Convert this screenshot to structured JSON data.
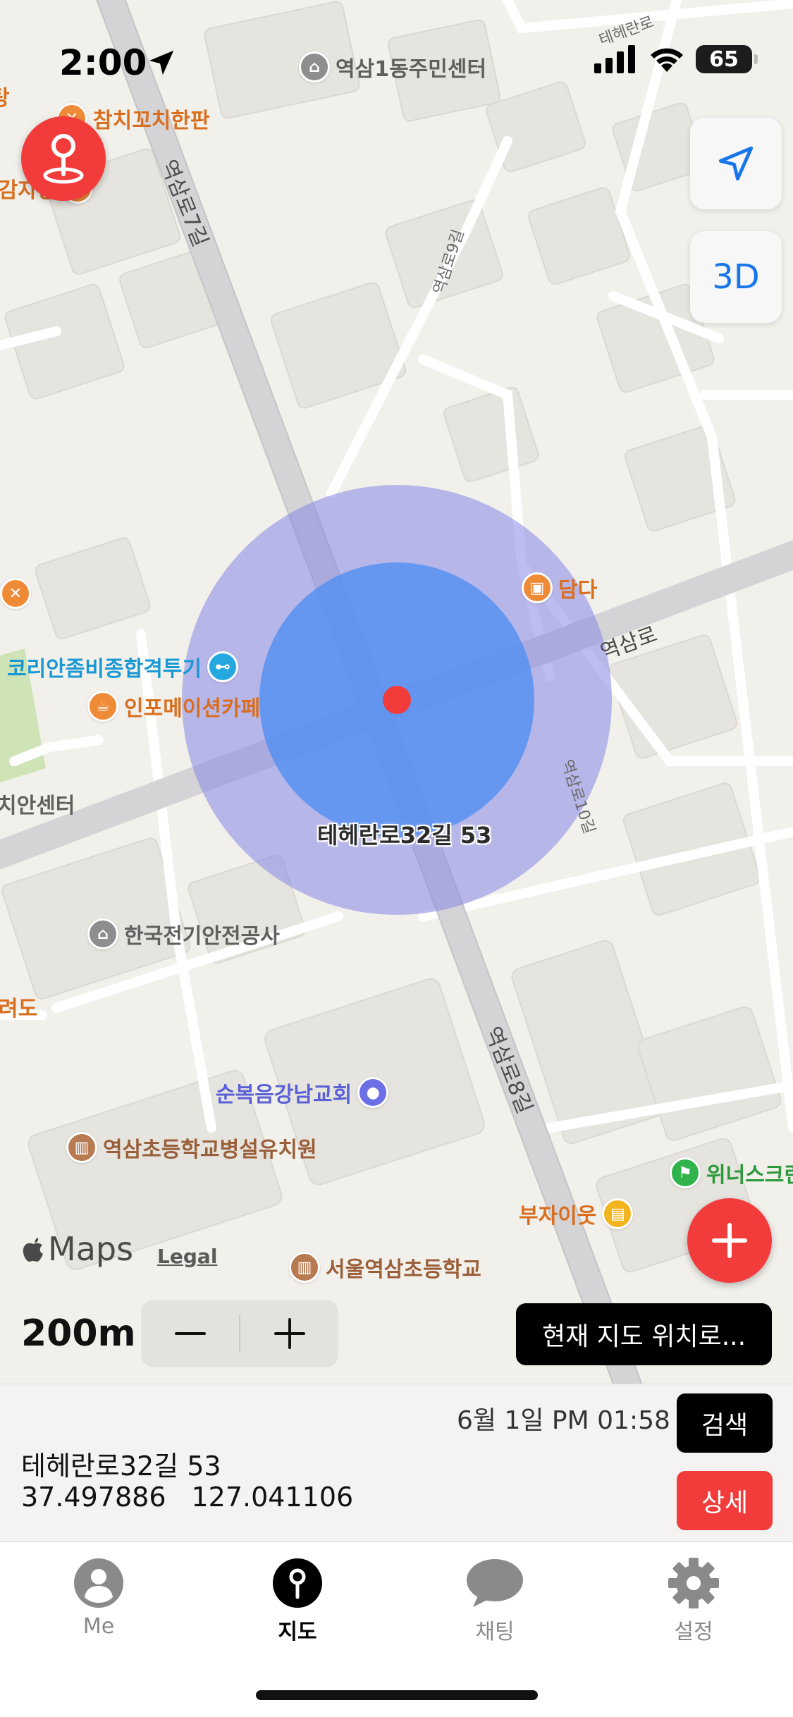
{
  "status_bar": {
    "time": "2:00",
    "battery": "65",
    "icons": [
      "location-arrow-icon",
      "cellular-signal-icon",
      "wifi-icon",
      "battery-icon"
    ]
  },
  "map": {
    "pois": [
      {
        "label": "역삼1동주민센터",
        "icon": "government-icon",
        "color": "gray"
      },
      {
        "label": "참치꼬치한판",
        "icon": "restaurant-icon",
        "color": "orange"
      },
      {
        "label": "편감자탕",
        "icon": "restaurant-icon",
        "color": "orange"
      },
      {
        "label": "탕",
        "icon": "restaurant-icon",
        "color": "orange"
      },
      {
        "label": "담다",
        "icon": "restaurant-icon",
        "color": "orange"
      },
      {
        "label": "코리안좀비종합격투기",
        "icon": "gym-icon",
        "color": "blue"
      },
      {
        "label": "인포메이션카페",
        "icon": "cafe-icon",
        "color": "orange"
      },
      {
        "label": "치안센터",
        "icon": "",
        "color": "gray"
      },
      {
        "label": "한국전기안전공사",
        "icon": "government-icon",
        "color": "gray"
      },
      {
        "label": "려도",
        "icon": "",
        "color": "orange"
      },
      {
        "label": "순복음강남교회",
        "icon": "church-icon",
        "color": "purple"
      },
      {
        "label": "역삼초등학교병설유치원",
        "icon": "school-icon",
        "color": "brown"
      },
      {
        "label": "위너스크린",
        "icon": "golf-icon",
        "color": "green"
      },
      {
        "label": "부자이웃",
        "icon": "shopping-icon",
        "color": "yellow"
      },
      {
        "label": "서울역삼초등학교",
        "icon": "school-icon",
        "color": "brown"
      }
    ],
    "roads": [
      "역삼로7길",
      "역삼로9길",
      "역삼로",
      "역삼로10길",
      "역삼로8길",
      "테헤란로"
    ],
    "selected_address_label": "테헤란로32길 53",
    "three_d_label": "3D",
    "attribution": {
      "brand": "Maps",
      "legal": "Legal"
    },
    "scale": "200m",
    "current_position_button": "현재 지도 위치로...",
    "colors": {
      "accent_red": "#f23c3c",
      "radius_outer": "#a8a8ee",
      "radius_inner": "#5f96f0",
      "threed_blue": "#1976e8"
    }
  },
  "info_panel": {
    "date": "6월 1일 PM 01:58",
    "address": "테헤란로32길 53",
    "latitude": "37.497886",
    "longitude": "127.041106",
    "search_button": "검색",
    "detail_button": "상세"
  },
  "tab_bar": {
    "tabs": [
      {
        "label": "Me",
        "icon": "person-icon",
        "active": false
      },
      {
        "label": "지도",
        "icon": "pin-icon",
        "active": true
      },
      {
        "label": "채팅",
        "icon": "chat-bubble-icon",
        "active": false
      },
      {
        "label": "설정",
        "icon": "gear-icon",
        "active": false
      }
    ]
  }
}
